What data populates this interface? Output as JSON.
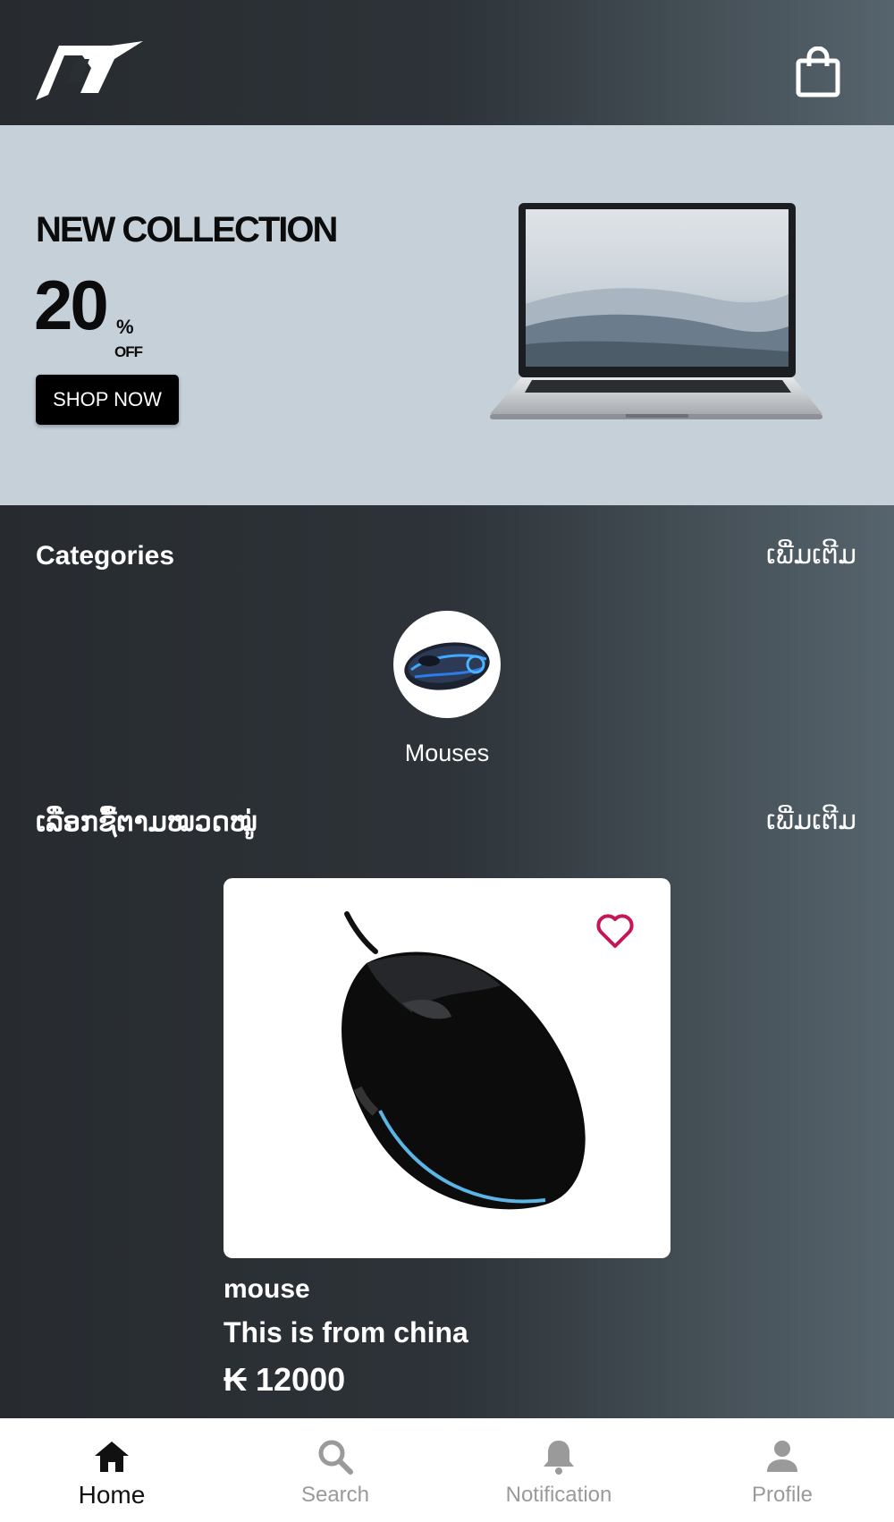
{
  "banner": {
    "title": "NEW COLLECTION",
    "discount": "20",
    "percent_sign": "%",
    "off_label": "OFF",
    "shop_button": "SHOP NOW"
  },
  "categories": {
    "title": "Categories",
    "more": "ເພີ່ມເຕີມ",
    "items": [
      {
        "label": "Mouses"
      }
    ]
  },
  "browse": {
    "title": "ເລືອກຊື້ຕາມໝວດໝູ່",
    "more": "ເພີ່ມເຕີມ"
  },
  "product": {
    "name": "mouse",
    "description": "This is from china",
    "price": "₭ 12000",
    "favorite_icon": "heart-outline-icon"
  },
  "nav": {
    "items": [
      {
        "label": "Home",
        "icon": "home-icon",
        "active": true
      },
      {
        "label": "Search",
        "icon": "search-icon",
        "active": false
      },
      {
        "label": "Notification",
        "icon": "bell-icon",
        "active": false
      },
      {
        "label": "Profile",
        "icon": "person-icon",
        "active": false
      }
    ]
  },
  "colors": {
    "banner_bg": "#c6d0d9",
    "favorite": "#c2185b",
    "nav_active": "#111111",
    "nav_inactive": "#9a9a9a"
  }
}
